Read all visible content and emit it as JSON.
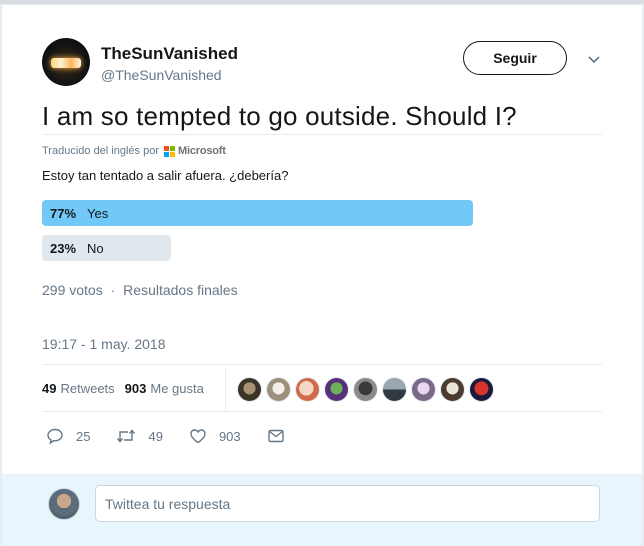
{
  "account": {
    "display_name": "TheSunVanished",
    "handle": "@TheSunVanished"
  },
  "follow_label": "Seguir",
  "tweet": {
    "text": "I am so tempted to go outside. Should I?",
    "translated_prefix": "Traducido del inglés por",
    "translator": "Microsoft",
    "translation": "Estoy tan tentado a salir afuera. ¿debería?"
  },
  "poll": {
    "options": [
      {
        "percent_label": "77%",
        "label": "Yes",
        "percent": 77,
        "color": "#71c9f8"
      },
      {
        "percent_label": "23%",
        "label": "No",
        "percent": 23,
        "color": "#e1e8ed"
      }
    ],
    "votes": "299 votos",
    "separator": "·",
    "status": "Resultados finales"
  },
  "timestamp": "19:17 - 1 may. 2018",
  "stats": {
    "retweets_count": "49",
    "retweets_label": "Retweets",
    "likes_count": "903",
    "likes_label": "Me gusta"
  },
  "actions": {
    "replies": "25",
    "retweets": "49",
    "likes": "903"
  },
  "reply": {
    "placeholder": "Twittea tu respuesta"
  },
  "colors": {
    "accent": "#1da1f2",
    "text": "#14171a",
    "muted": "#657786",
    "border": "#e6ecf0"
  }
}
